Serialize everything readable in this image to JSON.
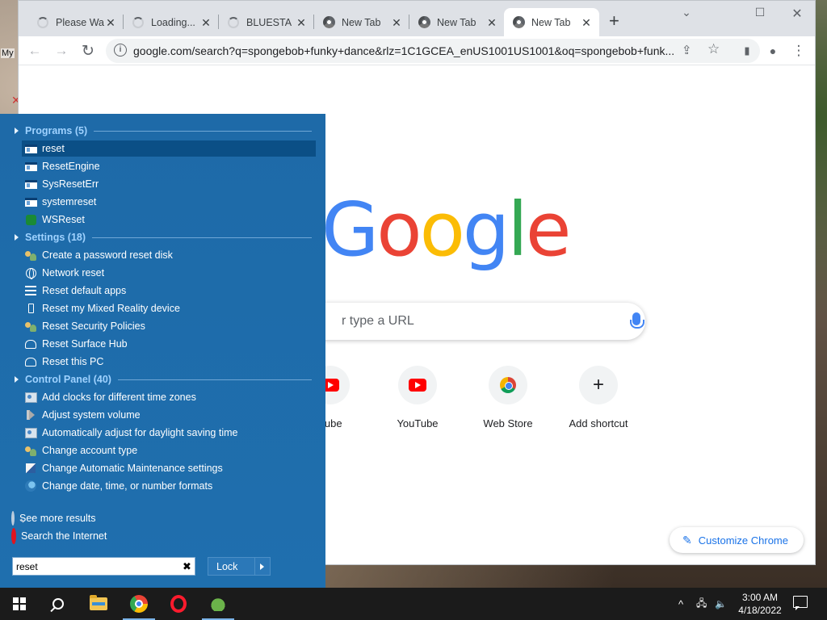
{
  "desktop": {
    "label": "My"
  },
  "chrome": {
    "tabs": [
      {
        "title": "Please Wa",
        "icon": "loading-spinner",
        "active": false
      },
      {
        "title": "Loading...",
        "icon": "loading-spinner",
        "active": false
      },
      {
        "title": "BLUESTA",
        "icon": "loading-spinner",
        "active": false
      },
      {
        "title": "New Tab",
        "icon": "chrome-icon",
        "active": false
      },
      {
        "title": "New Tab",
        "icon": "chrome-icon",
        "active": false
      },
      {
        "title": "New Tab",
        "icon": "chrome-icon",
        "active": true
      }
    ],
    "close_glyph": "✕",
    "new_tab_glyph": "+",
    "window_controls": {
      "minimize": "⌄",
      "maximize": "☐",
      "close": "✕"
    },
    "toolbar": {
      "back": "←",
      "forward": "→",
      "reload": "↻",
      "share": "⇪",
      "star": "☆",
      "sidepanel": "▮",
      "profile": "●",
      "menu": "⋮"
    },
    "omnibox": {
      "info_glyph": "i",
      "url": "google.com/search?q=spongebob+funky+dance&rlz=1C1GCEA_enUS1001US1001&oq=spongebob+funk..."
    },
    "ntp": {
      "logo_letters": [
        "G",
        "o",
        "o",
        "g",
        "l",
        "e"
      ],
      "logo_colors": [
        "#4285f4",
        "#ea4335",
        "#fbbc05",
        "#4285f4",
        "#34a853",
        "#ea4335"
      ],
      "search_placeholder": "r type a URL",
      "shortcuts": [
        {
          "label": "Tube",
          "icon": "youtube-icon"
        },
        {
          "label": "YouTube",
          "icon": "youtube-icon"
        },
        {
          "label": "Web Store",
          "icon": "web-store-icon"
        },
        {
          "label": "Add shortcut",
          "icon": "plus-icon"
        }
      ],
      "plus_glyph": "+",
      "customize_label": "Customize Chrome",
      "customize_glyph": "✎"
    }
  },
  "startmenu": {
    "groups": [
      {
        "header": "Programs (5)",
        "items": [
          {
            "label": "reset",
            "icon": "program-icon",
            "selected": true
          },
          {
            "label": "ResetEngine",
            "icon": "program-icon"
          },
          {
            "label": "SysResetErr",
            "icon": "program-icon"
          },
          {
            "label": "systemreset",
            "icon": "program-icon"
          },
          {
            "label": "WSReset",
            "icon": "wsreset-icon"
          }
        ]
      },
      {
        "header": "Settings (18)",
        "items": [
          {
            "label": "Create a password reset disk",
            "icon": "users-icon"
          },
          {
            "label": "Network reset",
            "icon": "globe-icon"
          },
          {
            "label": "Reset default apps",
            "icon": "list-icon"
          },
          {
            "label": "Reset my Mixed Reality device",
            "icon": "device-icon"
          },
          {
            "label": "Reset Security Policies",
            "icon": "users-icon"
          },
          {
            "label": "Reset Surface Hub",
            "icon": "surface-hub-icon"
          },
          {
            "label": "Reset this PC",
            "icon": "surface-hub-icon"
          }
        ]
      },
      {
        "header": "Control Panel (40)",
        "items": [
          {
            "label": "Add clocks for different time zones",
            "icon": "control-panel-icon"
          },
          {
            "label": "Adjust system volume",
            "icon": "speaker-icon"
          },
          {
            "label": "Automatically adjust for daylight saving time",
            "icon": "control-panel-icon"
          },
          {
            "label": "Change account type",
            "icon": "users-icon"
          },
          {
            "label": "Change Automatic Maintenance settings",
            "icon": "flag-icon"
          },
          {
            "label": "Change date, time, or number formats",
            "icon": "region-format-icon"
          }
        ]
      }
    ],
    "see_more": "See more results",
    "search_internet": "Search the Internet",
    "search_value": "reset",
    "clear_glyph": "✖",
    "lock_label": "Lock"
  },
  "taskbar": {
    "apps": [
      {
        "name": "file-explorer",
        "running": false
      },
      {
        "name": "chrome",
        "running": true
      },
      {
        "name": "opera",
        "running": false
      },
      {
        "name": "bluestacks",
        "running": true
      }
    ],
    "tray": {
      "chevron": "^",
      "network": "🖧",
      "volume": "🔈"
    },
    "time": "3:00 AM",
    "date": "4/18/2022"
  }
}
